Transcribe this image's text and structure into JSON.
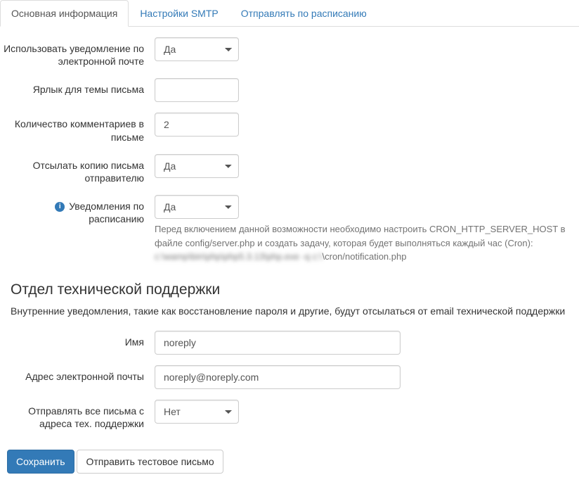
{
  "tabs": [
    {
      "label": "Основная информация"
    },
    {
      "label": "Настройки SMTP"
    },
    {
      "label": "Отправлять по расписанию"
    }
  ],
  "fields": {
    "useEmailNotification": {
      "label": "Использовать уведомление по электронной почте",
      "value": "Да"
    },
    "subjectTag": {
      "label": "Ярлык для темы письма",
      "value": ""
    },
    "commentsCount": {
      "label": "Количество комментариев в письме",
      "value": "2"
    },
    "sendCopy": {
      "label": "Отсылать копию письма отправителю",
      "value": "Да"
    },
    "scheduledNotifications": {
      "label": "Уведомления по расписанию",
      "value": "Да",
      "help_line1": "Перед включением данной возможности необходимо настроить CRON_HTTP_SERVER_HOST в файле config/server.php и создать задачу, которая будет выполняться каждый час (Cron):",
      "help_blurred": "c:\\wamp\\bin\\php\\php5.3.13\\php.exe -q c:\\",
      "help_suffix": "\\cron/notification.php"
    }
  },
  "supportSection": {
    "title": "Отдел технической поддержки",
    "description": "Внутренние уведомления, такие как восстановление пароля и другие, будут отсылаться от email технической поддержки",
    "name": {
      "label": "Имя",
      "value": "noreply"
    },
    "email": {
      "label": "Адрес электронной почты",
      "value": "noreply@noreply.com"
    },
    "sendAll": {
      "label": "Отправлять все письма с адреса тех. поддержки",
      "value": "Нет"
    }
  },
  "actions": {
    "save": "Сохранить",
    "test": "Отправить тестовое письмо"
  },
  "options": {
    "yes": "Да",
    "no": "Нет"
  }
}
